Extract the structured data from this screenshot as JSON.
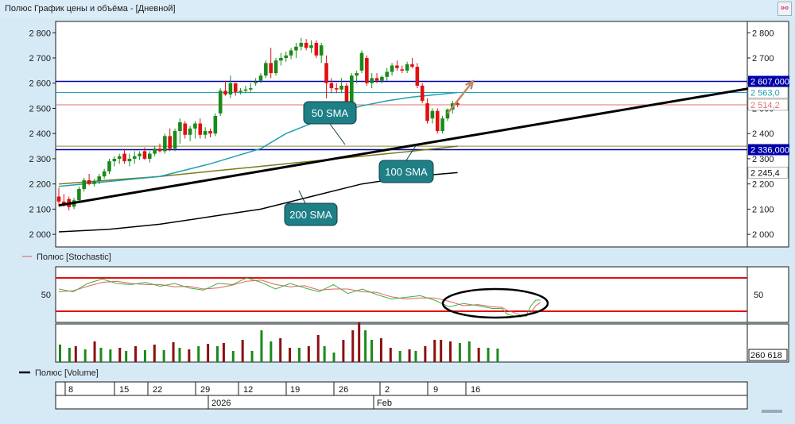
{
  "window": {
    "title": "Полюс График цены и объёма - [Дневной]"
  },
  "chart_data": {
    "type": "candlestick",
    "main": {
      "y_ticks": [
        {
          "v": 2000,
          "t": "2 000"
        },
        {
          "v": 2100,
          "t": "2 100"
        },
        {
          "v": 2200,
          "t": "2 200"
        },
        {
          "v": 2300,
          "t": "2 300"
        },
        {
          "v": 2400,
          "t": "2 400"
        },
        {
          "v": 2500,
          "t": "2 500"
        },
        {
          "v": 2600,
          "t": "2 600"
        },
        {
          "v": 2700,
          "t": "2 700"
        },
        {
          "v": 2800,
          "t": "2 800"
        }
      ],
      "ylim": [
        1950,
        2845
      ],
      "level_badges": [
        {
          "value": 2607,
          "text": "2 607,000",
          "color": "#0000aa"
        },
        {
          "value": 2336,
          "text": "2 336,000",
          "color": "#0000aa"
        }
      ],
      "level_labels": [
        {
          "value": 2563,
          "text": "2 563,0",
          "color": "#20a0b0"
        },
        {
          "value": 2514.2,
          "text": "2 514,2",
          "color": "#e07070"
        },
        {
          "value": 2245.4,
          "text": "2 245,4",
          "color": "#111111"
        }
      ],
      "annotations": [
        "50 SMA",
        "100 SMA",
        "200 SMA"
      ]
    },
    "candles": [
      [
        2150,
        2185,
        2110,
        2130
      ],
      [
        2130,
        2160,
        2110,
        2120
      ],
      [
        2140,
        2150,
        2095,
        2108
      ],
      [
        2110,
        2145,
        2100,
        2135
      ],
      [
        2135,
        2190,
        2125,
        2180
      ],
      [
        2180,
        2225,
        2170,
        2215
      ],
      [
        2215,
        2240,
        2195,
        2200
      ],
      [
        2200,
        2220,
        2190,
        2210
      ],
      [
        2210,
        2240,
        2200,
        2230
      ],
      [
        2230,
        2260,
        2220,
        2250
      ],
      [
        2250,
        2300,
        2240,
        2290
      ],
      [
        2290,
        2310,
        2270,
        2300
      ],
      [
        2300,
        2320,
        2280,
        2310
      ],
      [
        2320,
        2340,
        2280,
        2290
      ],
      [
        2290,
        2320,
        2270,
        2300
      ],
      [
        2300,
        2330,
        2280,
        2310
      ],
      [
        2310,
        2330,
        2295,
        2320
      ],
      [
        2330,
        2345,
        2295,
        2300
      ],
      [
        2300,
        2330,
        2285,
        2320
      ],
      [
        2320,
        2350,
        2310,
        2340
      ],
      [
        2340,
        2360,
        2325,
        2330
      ],
      [
        2330,
        2400,
        2320,
        2390
      ],
      [
        2390,
        2420,
        2330,
        2340
      ],
      [
        2340,
        2420,
        2330,
        2410
      ],
      [
        2410,
        2460,
        2360,
        2445
      ],
      [
        2440,
        2450,
        2380,
        2395
      ],
      [
        2395,
        2430,
        2370,
        2420
      ],
      [
        2420,
        2450,
        2380,
        2440
      ],
      [
        2440,
        2460,
        2380,
        2395
      ],
      [
        2395,
        2425,
        2380,
        2410
      ],
      [
        2410,
        2420,
        2385,
        2400
      ],
      [
        2400,
        2480,
        2390,
        2470
      ],
      [
        2480,
        2580,
        2470,
        2570
      ],
      [
        2570,
        2610,
        2550,
        2555
      ],
      [
        2555,
        2630,
        2540,
        2600
      ],
      [
        2600,
        2600,
        2550,
        2565
      ],
      [
        2565,
        2580,
        2555,
        2570
      ],
      [
        2570,
        2590,
        2560,
        2575
      ],
      [
        2575,
        2600,
        2565,
        2580
      ],
      [
        2600,
        2620,
        2590,
        2605
      ],
      [
        2610,
        2640,
        2600,
        2630
      ],
      [
        2630,
        2690,
        2620,
        2680
      ],
      [
        2680,
        2740,
        2620,
        2640
      ],
      [
        2640,
        2700,
        2630,
        2690
      ],
      [
        2690,
        2720,
        2670,
        2700
      ],
      [
        2700,
        2725,
        2685,
        2710
      ],
      [
        2710,
        2740,
        2695,
        2730
      ],
      [
        2730,
        2760,
        2700,
        2745
      ],
      [
        2745,
        2780,
        2730,
        2760
      ],
      [
        2760,
        2775,
        2730,
        2740
      ],
      [
        2740,
        2770,
        2720,
        2750
      ],
      [
        2760,
        2770,
        2700,
        2710
      ],
      [
        2710,
        2760,
        2680,
        2750
      ],
      [
        2680,
        2710,
        2540,
        2600
      ],
      [
        2600,
        2620,
        2560,
        2580
      ],
      [
        2580,
        2600,
        2560,
        2575
      ],
      [
        2575,
        2620,
        2560,
        2590
      ],
      [
        2590,
        2600,
        2510,
        2520
      ],
      [
        2520,
        2640,
        2510,
        2630
      ],
      [
        2630,
        2650,
        2600,
        2640
      ],
      [
        2650,
        2730,
        2640,
        2720
      ],
      [
        2700,
        2710,
        2590,
        2600
      ],
      [
        2600,
        2640,
        2580,
        2620
      ],
      [
        2620,
        2640,
        2600,
        2610
      ],
      [
        2610,
        2630,
        2600,
        2625
      ],
      [
        2625,
        2660,
        2610,
        2645
      ],
      [
        2645,
        2680,
        2630,
        2670
      ],
      [
        2670,
        2690,
        2650,
        2660
      ],
      [
        2655,
        2670,
        2640,
        2650
      ],
      [
        2650,
        2685,
        2640,
        2675
      ],
      [
        2675,
        2700,
        2660,
        2665
      ],
      [
        2665,
        2680,
        2580,
        2590
      ],
      [
        2590,
        2600,
        2520,
        2530
      ],
      [
        2520,
        2540,
        2440,
        2450
      ],
      [
        2460,
        2500,
        2440,
        2490
      ],
      [
        2490,
        2500,
        2400,
        2410
      ],
      [
        2410,
        2470,
        2400,
        2460
      ],
      [
        2460,
        2500,
        2450,
        2495
      ],
      [
        2495,
        2530,
        2480,
        2520
      ],
      [
        2520,
        2530,
        2505,
        2515
      ]
    ],
    "sma50": [
      [
        0,
        2190
      ],
      [
        10,
        2210
      ],
      [
        20,
        2230
      ],
      [
        30,
        2280
      ],
      [
        40,
        2340
      ],
      [
        45,
        2400
      ],
      [
        50,
        2440
      ],
      [
        55,
        2480
      ],
      [
        60,
        2510
      ],
      [
        65,
        2530
      ],
      [
        70,
        2545
      ],
      [
        75,
        2555
      ],
      [
        79,
        2563
      ]
    ],
    "sma100": [
      [
        0,
        2200
      ],
      [
        10,
        2215
      ],
      [
        20,
        2230
      ],
      [
        30,
        2250
      ],
      [
        40,
        2270
      ],
      [
        50,
        2290
      ],
      [
        60,
        2310
      ],
      [
        70,
        2330
      ],
      [
        79,
        2350
      ]
    ],
    "sma200": [
      [
        0,
        2010
      ],
      [
        10,
        2020
      ],
      [
        20,
        2040
      ],
      [
        30,
        2070
      ],
      [
        40,
        2100
      ],
      [
        50,
        2150
      ],
      [
        60,
        2200
      ],
      [
        70,
        2230
      ],
      [
        79,
        2245
      ]
    ],
    "trendline": [
      [
        0,
        2115
      ],
      [
        140,
        2590
      ]
    ],
    "arrow": [
      [
        77,
        2480
      ],
      [
        82,
        2607
      ]
    ],
    "stochastic": {
      "label": "Полюс [Stochastic]",
      "y_ticks": [
        {
          "v": 50,
          "t": "50"
        }
      ],
      "ylim": [
        0,
        100
      ],
      "upper": 80,
      "lower": 20,
      "k": [
        [
          0,
          60
        ],
        [
          3,
          55
        ],
        [
          6,
          70
        ],
        [
          9,
          78
        ],
        [
          12,
          70
        ],
        [
          15,
          68
        ],
        [
          18,
          72
        ],
        [
          21,
          65
        ],
        [
          24,
          70
        ],
        [
          27,
          62
        ],
        [
          30,
          58
        ],
        [
          33,
          70
        ],
        [
          36,
          68
        ],
        [
          39,
          80
        ],
        [
          42,
          72
        ],
        [
          45,
          60
        ],
        [
          48,
          70
        ],
        [
          51,
          62
        ],
        [
          54,
          55
        ],
        [
          57,
          68
        ],
        [
          60,
          52
        ],
        [
          63,
          60
        ],
        [
          66,
          50
        ],
        [
          69,
          42
        ],
        [
          72,
          45
        ],
        [
          75,
          48
        ],
        [
          78,
          40
        ],
        [
          81,
          28
        ],
        [
          84,
          34
        ],
        [
          87,
          30
        ],
        [
          90,
          25
        ],
        [
          92,
          25
        ],
        [
          93,
          15
        ],
        [
          95,
          10
        ],
        [
          96,
          10
        ],
        [
          97,
          12
        ],
        [
          98,
          30
        ],
        [
          99,
          40
        ],
        [
          100,
          40
        ]
      ],
      "d": [
        [
          0,
          55
        ],
        [
          3,
          57
        ],
        [
          6,
          65
        ],
        [
          9,
          72
        ],
        [
          12,
          74
        ],
        [
          15,
          70
        ],
        [
          18,
          68
        ],
        [
          21,
          68
        ],
        [
          24,
          64
        ],
        [
          27,
          65
        ],
        [
          30,
          60
        ],
        [
          33,
          62
        ],
        [
          36,
          67
        ],
        [
          39,
          74
        ],
        [
          42,
          76
        ],
        [
          45,
          68
        ],
        [
          48,
          64
        ],
        [
          51,
          66
        ],
        [
          54,
          58
        ],
        [
          57,
          60
        ],
        [
          60,
          60
        ],
        [
          63,
          55
        ],
        [
          66,
          54
        ],
        [
          69,
          46
        ],
        [
          72,
          42
        ],
        [
          75,
          44
        ],
        [
          78,
          44
        ],
        [
          81,
          38
        ],
        [
          84,
          30
        ],
        [
          87,
          32
        ],
        [
          90,
          28
        ],
        [
          92,
          27
        ],
        [
          93,
          22
        ],
        [
          95,
          16
        ],
        [
          96,
          12
        ],
        [
          97,
          11
        ],
        [
          98,
          18
        ],
        [
          99,
          30
        ],
        [
          100,
          36
        ]
      ]
    },
    "volume": {
      "label": "Полюс [Volume]",
      "badge": "260 618",
      "bars": [
        [
          0,
          "g",
          22
        ],
        [
          3,
          "g",
          18
        ],
        [
          5,
          "r",
          20
        ],
        [
          8,
          "g",
          16
        ],
        [
          11,
          "r",
          26
        ],
        [
          13,
          "g",
          18
        ],
        [
          16,
          "g",
          16
        ],
        [
          19,
          "r",
          18
        ],
        [
          21,
          "g",
          14
        ],
        [
          24,
          "r",
          20
        ],
        [
          27,
          "g",
          15
        ],
        [
          30,
          "r",
          22
        ],
        [
          33,
          "g",
          15
        ],
        [
          36,
          "r",
          25
        ],
        [
          38,
          "g",
          18
        ],
        [
          41,
          "r",
          16
        ],
        [
          44,
          "g",
          20
        ],
        [
          47,
          "r",
          23
        ],
        [
          50,
          "g",
          20
        ],
        [
          52,
          "r",
          24
        ],
        [
          55,
          "g",
          14
        ],
        [
          58,
          "r",
          28
        ],
        [
          61,
          "g",
          14
        ],
        [
          64,
          "g",
          40
        ],
        [
          67,
          "g",
          26
        ],
        [
          70,
          "r",
          30
        ],
        [
          73,
          "r",
          18
        ],
        [
          76,
          "g",
          18
        ],
        [
          79,
          "r",
          20
        ],
        [
          82,
          "r",
          34
        ],
        [
          84,
          "g",
          20
        ],
        [
          87,
          "g",
          12
        ],
        [
          90,
          "r",
          28
        ],
        [
          93,
          "r",
          40
        ],
        [
          95,
          "r",
          50
        ],
        [
          97,
          "g",
          40
        ],
        [
          99,
          "g",
          28
        ],
        [
          102,
          "r",
          30
        ],
        [
          105,
          "r",
          18
        ],
        [
          108,
          "g",
          14
        ],
        [
          111,
          "r",
          16
        ],
        [
          113,
          "g",
          14
        ],
        [
          116,
          "r",
          20
        ],
        [
          119,
          "r",
          28
        ],
        [
          121,
          "r",
          28
        ],
        [
          124,
          "r",
          26
        ],
        [
          127,
          "g",
          24
        ],
        [
          130,
          "g",
          26
        ],
        [
          133,
          "r",
          18
        ],
        [
          136,
          "g",
          18
        ],
        [
          139,
          "g",
          17
        ]
      ]
    },
    "x_axis": {
      "day_ticks": [
        "8",
        "15",
        "22",
        "29",
        "12",
        "19",
        "26",
        "2",
        "9",
        "16"
      ],
      "period_labels": [
        "2026",
        "Feb"
      ]
    }
  }
}
